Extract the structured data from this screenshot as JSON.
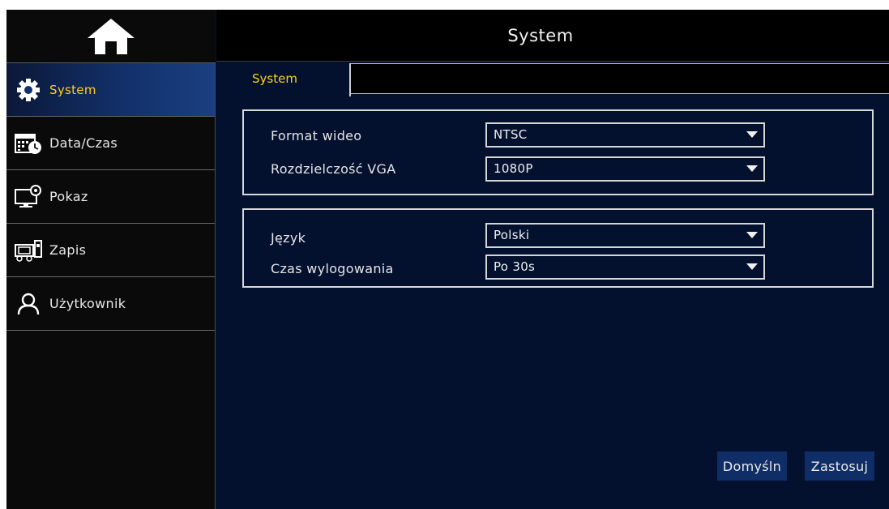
{
  "header": {
    "title": "System"
  },
  "sidebar": {
    "home_icon": "home-icon",
    "items": [
      {
        "label": "System",
        "icon": "gear-icon",
        "active": true
      },
      {
        "label": "Data/Czas",
        "icon": "calendar-clock-icon",
        "active": false
      },
      {
        "label": "Pokaz",
        "icon": "monitor-settings-icon",
        "active": false
      },
      {
        "label": "Zapis",
        "icon": "recorder-icon",
        "active": false
      },
      {
        "label": "Użytkownik",
        "icon": "user-icon",
        "active": false
      }
    ]
  },
  "tabs": [
    {
      "label": "System",
      "active": true
    }
  ],
  "panel1": {
    "rows": [
      {
        "label": "Format wideo",
        "value": "NTSC"
      },
      {
        "label": "Rozdzielczość VGA",
        "value": "1080P"
      }
    ]
  },
  "panel2": {
    "rows": [
      {
        "label": "Język",
        "value": "Polski"
      },
      {
        "label": "Czas wylogowania",
        "value": "Po 30s"
      }
    ]
  },
  "buttons": {
    "default_label": "Domyśln",
    "apply_label": "Zastosuj"
  },
  "colors": {
    "accent": "#ffd21e",
    "background": "#03102e",
    "sidebar": "#0a0a0a",
    "button": "#0f2d66"
  }
}
